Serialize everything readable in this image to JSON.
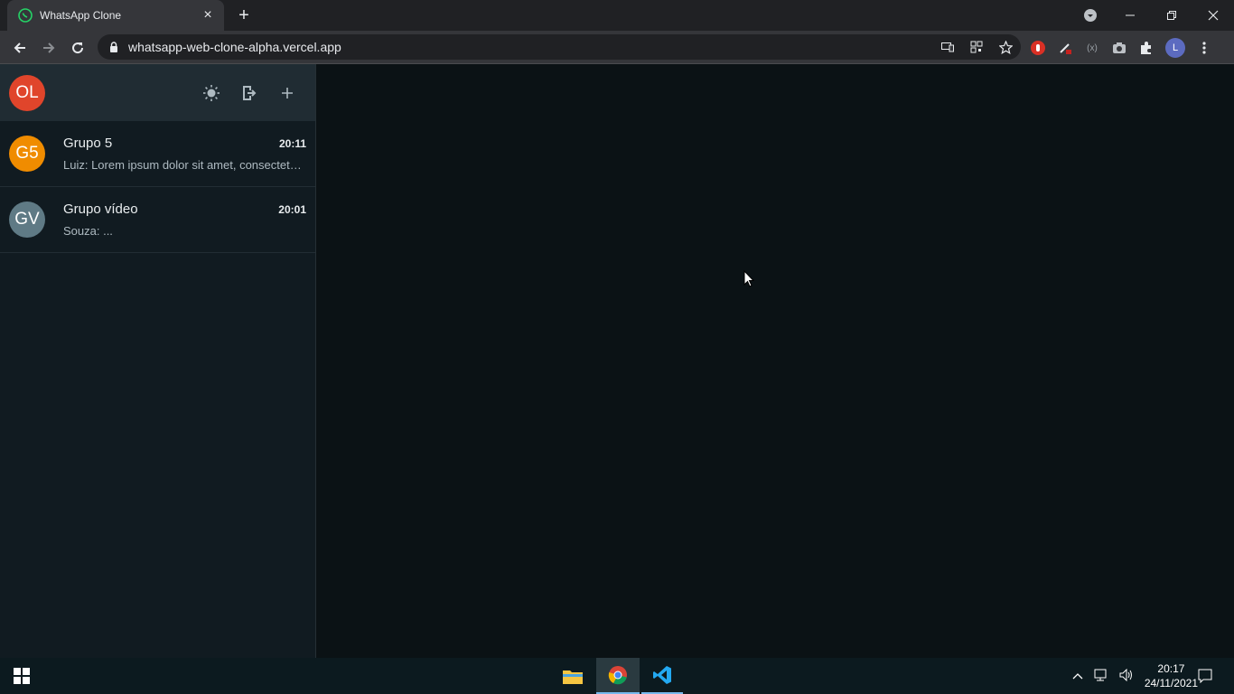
{
  "browser": {
    "tab_title": "WhatsApp Clone",
    "url": "whatsapp-web-clone-alpha.vercel.app",
    "profile_initial": "L"
  },
  "sidebar": {
    "user_initials": "OL",
    "user_avatar_color": "#e0452b",
    "chats": [
      {
        "initials": "G5",
        "avatar_color": "#f08c00",
        "name": "Grupo 5",
        "time": "20:11",
        "preview": "Luiz: Lorem ipsum dolor sit amet, consectetur adipiscing elit"
      },
      {
        "initials": "GV",
        "avatar_color": "#5f7a85",
        "name": "Grupo vídeo",
        "time": "20:01",
        "preview": "Souza: ..."
      }
    ]
  },
  "taskbar": {
    "time": "20:17",
    "date": "24/11/2021"
  },
  "colors": {
    "sidebar_bg": "#111b21",
    "header_bg": "#202c33",
    "main_bg": "#0b1215"
  }
}
